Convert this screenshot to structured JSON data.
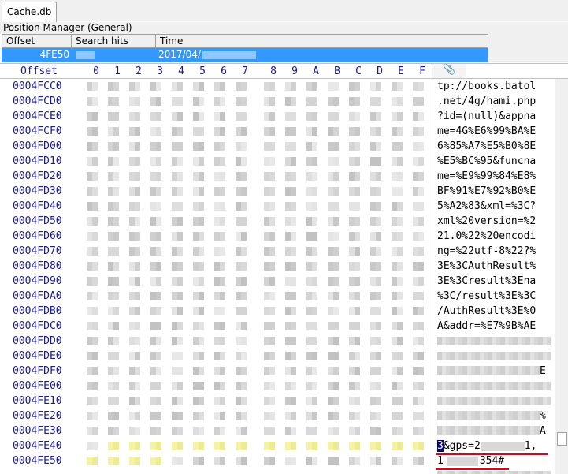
{
  "tab": {
    "label": "Cache.db"
  },
  "position_manager": {
    "title": "Position Manager (General)",
    "columns": [
      "Offset",
      "Search hits",
      "Time"
    ],
    "row": {
      "offset": "4FE50",
      "time": "2017/04/"
    }
  },
  "hex_header": {
    "offset_label": "Offset",
    "columns": [
      "0",
      "1",
      "2",
      "3",
      "4",
      "5",
      "6",
      "7",
      "8",
      "9",
      "A",
      "B",
      "C",
      "D",
      "E",
      "F"
    ],
    "clip_icon": "paperclip-icon"
  },
  "offsets": [
    "0004FCC0",
    "0004FCD0",
    "0004FCE0",
    "0004FCF0",
    "0004FD00",
    "0004FD10",
    "0004FD20",
    "0004FD30",
    "0004FD40",
    "0004FD50",
    "0004FD60",
    "0004FD70",
    "0004FD80",
    "0004FD90",
    "0004FDA0",
    "0004FDB0",
    "0004FDC0",
    "0004FDD0",
    "0004FDE0",
    "0004FDF0",
    "0004FE00",
    "0004FE10",
    "0004FE20",
    "0004FE30",
    "0004FE40",
    "0004FE50"
  ],
  "text_lines": [
    "tp://books.batol",
    ".net/4g/hami.php",
    "?id=(null)&appna",
    "me=4G%E6%99%BA%E",
    "6%85%A7%E5%B0%8E",
    "%E5%BC%95&funcna",
    "me=%E9%99%84%E8%",
    "BF%91%E7%92%B0%E",
    "5%A2%83&xml=%3C?",
    "xml%20version=%2",
    "21.0%22%20encodi",
    "ng=%22utf-8%22?%",
    "3E%3CAuthResult%",
    "3E%3Cresult%3Ena",
    "%3C/result%3E%3C",
    "/AuthResult%3E%0",
    "A&addr=%E7%9B%AE"
  ],
  "partial_text": {
    "fdf0_tail": "E",
    "fe20_tail": "%",
    "fe30": "A",
    "fe40_sel": "3",
    "fe40_text": "&gps=2",
    "fe40_tail": "1,",
    "fe50_head": "1",
    "fe50_tail": "354#"
  },
  "colors": {
    "selection": "#3399ff",
    "offset_text": "#1a1a8c",
    "highlight": "#ffff99",
    "underline": "#e0001a"
  }
}
